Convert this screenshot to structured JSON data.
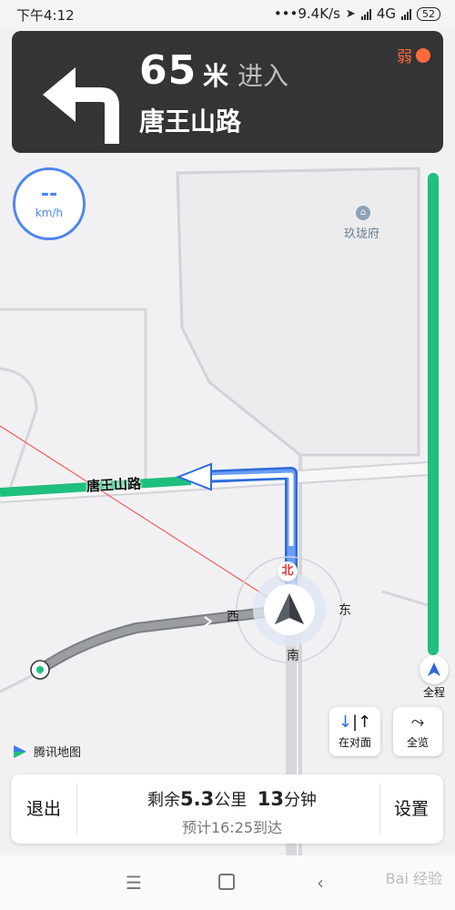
{
  "status_bar": {
    "time": "下午4:12",
    "net_speed": "•••9.4K/s",
    "network": "4G",
    "battery": "52"
  },
  "nav": {
    "distance": "65",
    "distance_unit": "米",
    "action": "进入",
    "road_name": "唐王山路",
    "gps_signal": "弱",
    "icon": "turn-left-arrow-icon"
  },
  "speed": {
    "value": "--",
    "unit": "km/h"
  },
  "map": {
    "poi_name": "玖珑府",
    "road_label": "唐王山路",
    "compass": {
      "north": "北",
      "south": "南",
      "east": "东",
      "west": "西"
    },
    "colors": {
      "route_blue": "#4f8cf0",
      "traffic_green": "#1fbf7d",
      "passed_gray": "#8a8d91"
    }
  },
  "route_progress": {
    "label": "全程"
  },
  "buttons": {
    "opposite_side": "在对面",
    "overview": "全览"
  },
  "brand": "腾讯地图",
  "bottom": {
    "exit": "退出",
    "settings": "设置",
    "remain_prefix": "剩余",
    "remain_distance": "5.3",
    "remain_distance_unit": "公里",
    "remain_time": "13",
    "remain_time_unit": "分钟",
    "eta": "预计16:25到达"
  },
  "watermark": "Bai 经验"
}
